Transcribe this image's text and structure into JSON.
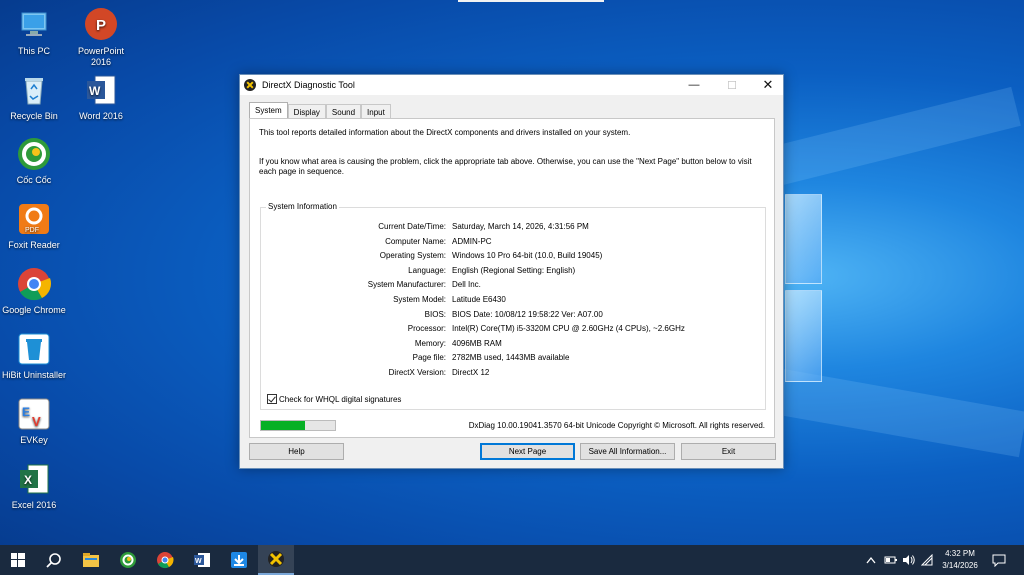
{
  "desktop": {
    "icons": [
      {
        "label": "This PC",
        "icon": "this-pc-icon"
      },
      {
        "label": "PowerPoint 2016",
        "icon": "powerpoint-icon",
        "color": "#d24726"
      },
      {
        "label": "Recycle Bin",
        "icon": "recycle-bin-icon"
      },
      {
        "label": "Word 2016",
        "icon": "word-icon",
        "color": "#2b579a"
      },
      {
        "label": "Cốc Cốc",
        "icon": "coccoc-icon",
        "color": "#2e9a3a"
      },
      {
        "label": "Foxit Reader",
        "icon": "foxit-icon",
        "color": "#f07b16"
      },
      {
        "label": "Google Chrome",
        "icon": "chrome-icon"
      },
      {
        "label": "HiBit Uninstaller",
        "icon": "hibit-icon",
        "color": "#1e90d6"
      },
      {
        "label": "EVKey",
        "icon": "evkey-icon"
      },
      {
        "label": "Excel 2016",
        "icon": "excel-icon",
        "color": "#217346"
      }
    ]
  },
  "dialog": {
    "title": "DirectX Diagnostic Tool",
    "tabs": [
      {
        "label": "System",
        "active": true
      },
      {
        "label": "Display",
        "active": false
      },
      {
        "label": "Sound",
        "active": false
      },
      {
        "label": "Input",
        "active": false
      }
    ],
    "intro_1": "This tool reports detailed information about the DirectX components and drivers installed on your system.",
    "intro_2": "If you know what area is causing the problem, click the appropriate tab above.  Otherwise, you can use the \"Next Page\" button below to visit each page in sequence.",
    "system_info": {
      "group_title": "System Information",
      "rows": [
        {
          "label": "Current Date/Time:",
          "value": "Saturday, March 14, 2026, 4:31:56 PM"
        },
        {
          "label": "Computer Name:",
          "value": "ADMIN-PC"
        },
        {
          "label": "Operating System:",
          "value": "Windows 10 Pro 64-bit (10.0, Build 19045)"
        },
        {
          "label": "Language:",
          "value": "English (Regional Setting: English)"
        },
        {
          "label": "System Manufacturer:",
          "value": "Dell Inc."
        },
        {
          "label": "System Model:",
          "value": "Latitude E6430"
        },
        {
          "label": "BIOS:",
          "value": "BIOS Date: 10/08/12 19:58:22 Ver: A07.00"
        },
        {
          "label": "Processor:",
          "value": "Intel(R) Core(TM) i5-3320M CPU @ 2.60GHz (4 CPUs), ~2.6GHz"
        },
        {
          "label": "Memory:",
          "value": "4096MB RAM"
        },
        {
          "label": "Page file:",
          "value": "2782MB used, 1443MB available"
        },
        {
          "label": "DirectX Version:",
          "value": "DirectX 12"
        }
      ]
    },
    "whql_label": "Check for WHQL digital signatures",
    "whql_checked": true,
    "progress_fraction": 0.6,
    "copyright": "DxDiag 10.00.19041.3570 64-bit Unicode  Copyright © Microsoft. All rights reserved.",
    "buttons": {
      "help": "Help",
      "next_page": "Next Page",
      "save_all": "Save All Information...",
      "exit": "Exit"
    }
  },
  "taskbar": {
    "apps": [
      "start-icon",
      "search-icon",
      "file-explorer-icon",
      "coccoc-icon",
      "chrome-icon",
      "word-icon",
      "download-icon",
      "directx-icon"
    ],
    "clock_time": "4:32 PM",
    "clock_date": "3/14/2026"
  },
  "colors": {
    "accent": "#0078d7",
    "progress": "#06b025",
    "taskbar": "#1a2a3f"
  }
}
